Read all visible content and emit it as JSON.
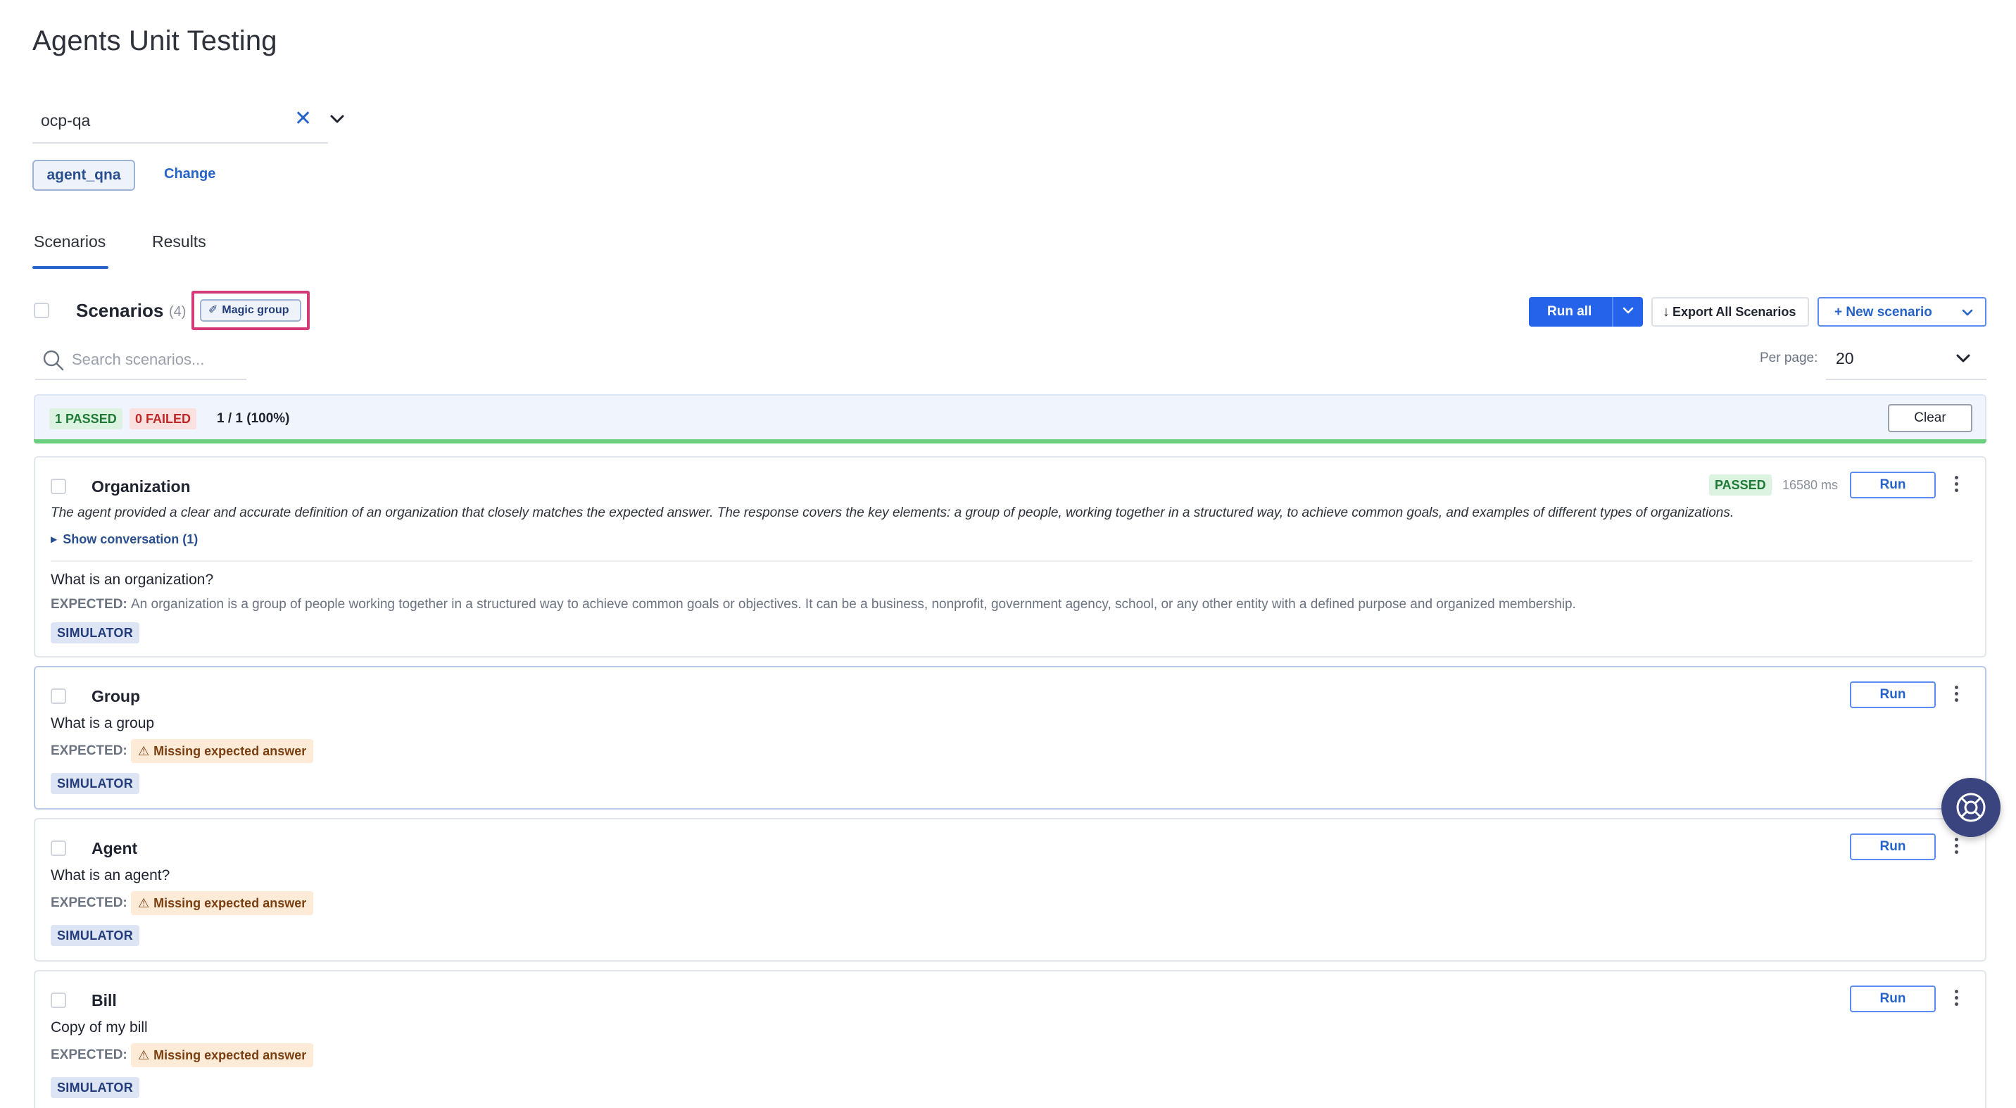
{
  "page": {
    "title": "Agents Unit Testing"
  },
  "project_selector": {
    "value": "ocp-qa"
  },
  "agent": {
    "name": "agent_qna",
    "change_label": "Change"
  },
  "tabs": [
    {
      "label": "Scenarios"
    },
    {
      "label": "Results"
    }
  ],
  "toolbar": {
    "heading": "Scenarios",
    "count": "(4)",
    "magic_group_label": "Magic group",
    "run_all_label": "Run all",
    "export_label": "Export All Scenarios",
    "new_scenario_label": "+ New scenario"
  },
  "search": {
    "placeholder": "Search scenarios..."
  },
  "per_page": {
    "label": "Per page:",
    "value": "20"
  },
  "summary": {
    "passed": "1 PASSED",
    "failed": "0 FAILED",
    "ratio": "1 / 1 (100%)",
    "clear_label": "Clear",
    "progress": 1.0
  },
  "scenarios": [
    {
      "name": "Organization",
      "status": "PASSED",
      "duration": "16580 ms",
      "run_label": "Run",
      "evaluation": "The agent provided a clear and accurate definition of an organization that closely matches the expected answer. The response covers the key elements: a group of people, working together in a structured way, to achieve common goals, and examples of different types of organizations.",
      "show_conversation": "Show conversation (1)",
      "question": "What is an organization?",
      "expected_label": "EXPECTED:",
      "expected": "An organization is a group of people working together in a structured way to achieve common goals or objectives. It can be a business, nonprofit, government agency, school, or any other entity with a defined purpose and organized membership.",
      "type": "SIMULATOR"
    },
    {
      "name": "Group",
      "run_label": "Run",
      "question": "What is a group",
      "expected_label": "EXPECTED:",
      "missing": "Missing expected answer",
      "type": "SIMULATOR"
    },
    {
      "name": "Agent",
      "run_label": "Run",
      "question": "What is an agent?",
      "expected_label": "EXPECTED:",
      "missing": "Missing expected answer",
      "type": "SIMULATOR"
    },
    {
      "name": "Bill",
      "run_label": "Run",
      "question": "Copy of my bill",
      "expected_label": "EXPECTED:",
      "missing": "Missing expected answer",
      "type": "SIMULATOR"
    }
  ],
  "colors": {
    "accent": "#2563eb",
    "passed": "#1f7a36",
    "failed": "#c02828",
    "warning_bg": "#fdebd8",
    "highlight_border": "#d23a78"
  },
  "icons": {
    "clear": "close-icon",
    "dropdown": "chevron-down-icon",
    "search": "search-icon",
    "magic": "magic-wand-icon",
    "export": "download-arrow-icon",
    "warning": "warning-icon",
    "more": "more-vertical-icon",
    "help": "help-lifebuoy-icon"
  }
}
